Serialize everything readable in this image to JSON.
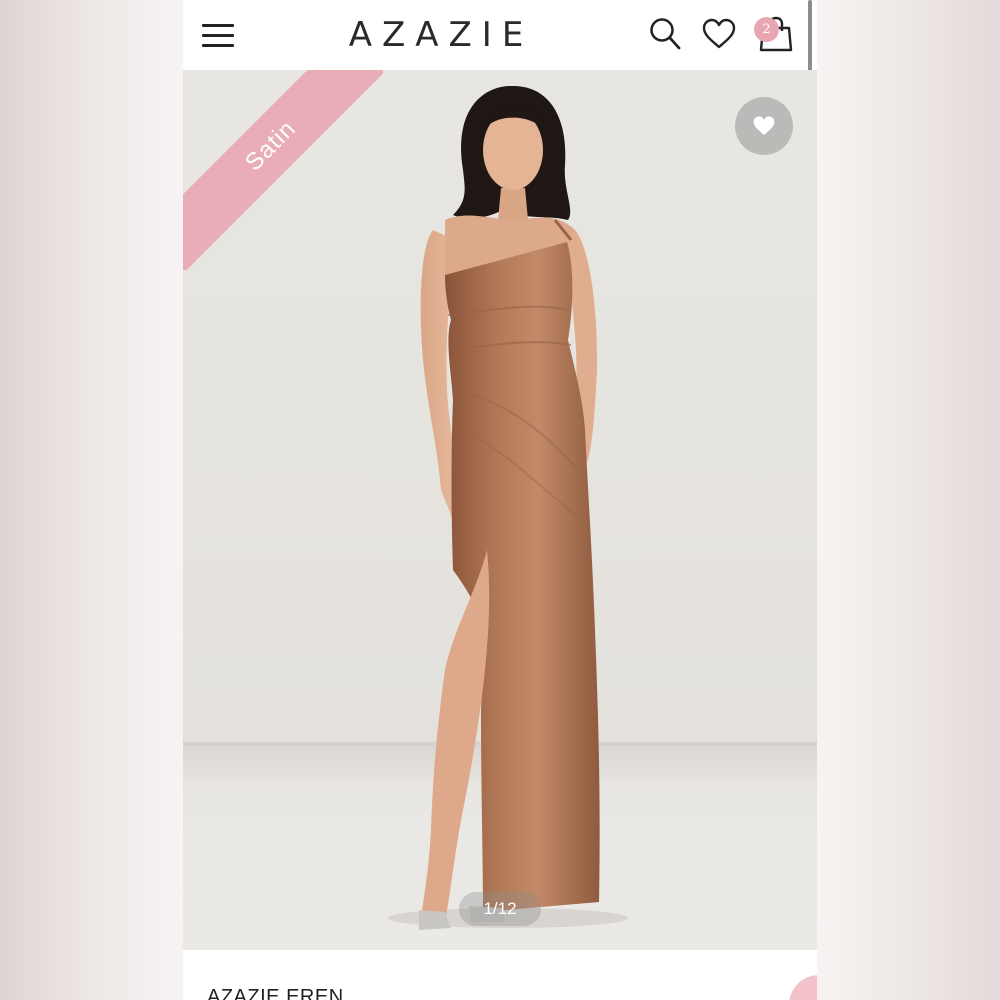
{
  "header": {
    "brand": "AZAZIE",
    "cart_count": "2",
    "icons": [
      "menu-icon",
      "search-icon",
      "heart-icon",
      "shopping-bag-icon"
    ]
  },
  "product_image": {
    "fabric_badge": "Satin",
    "image_counter": "1/12",
    "dress_color": "#a86e4e",
    "badge_color": "#e9adb7"
  },
  "product": {
    "title": "AZAZIE EREN"
  }
}
